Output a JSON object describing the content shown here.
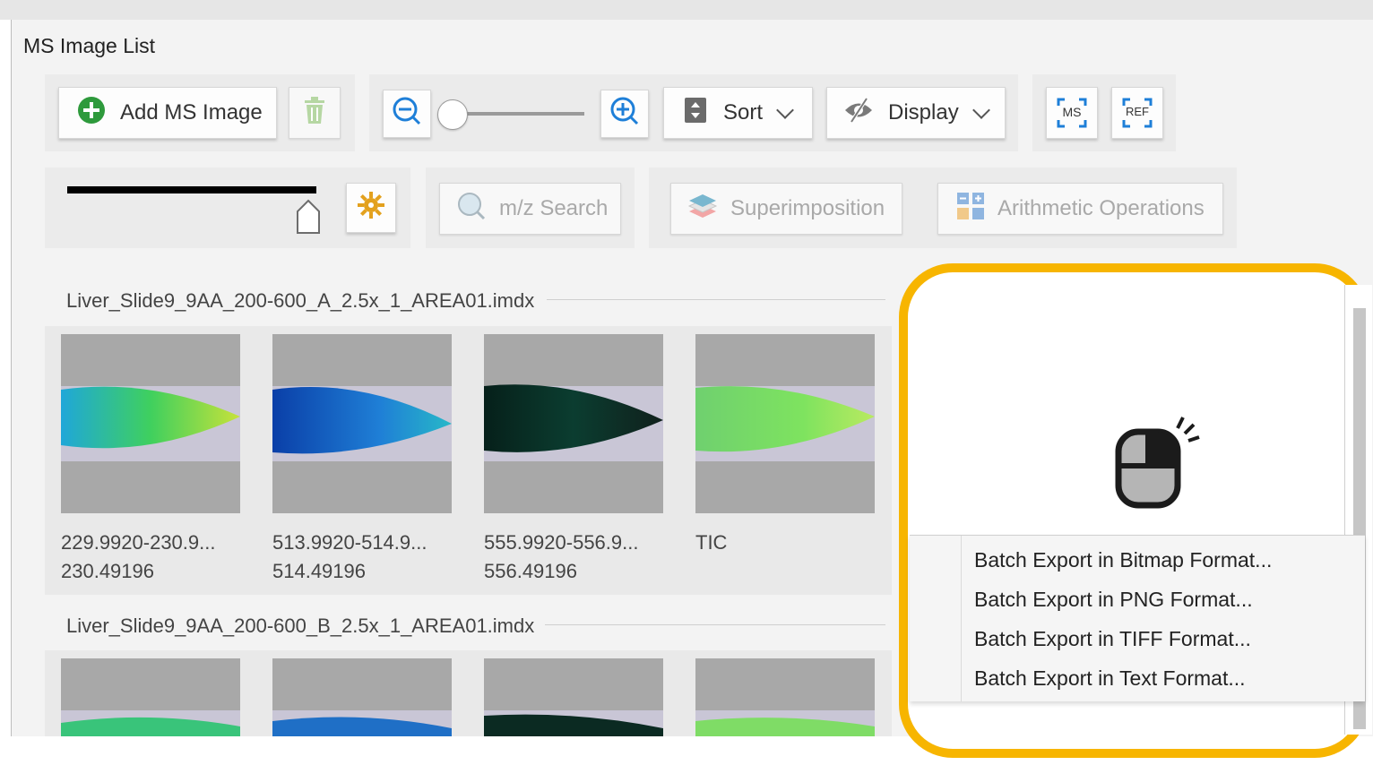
{
  "panel": {
    "title": "MS Image List"
  },
  "toolbar": {
    "add_ms_image": "Add MS Image",
    "sort": "Sort",
    "display": "Display",
    "ms_label": "MS",
    "ref_label": "REF",
    "mz_search": "m/z Search",
    "superimposition": "Superimposition",
    "arithmetic_operations": "Arithmetic Operations"
  },
  "sections": [
    {
      "title": "Liver_Slide9_9AA_200-600_A_2.5x_1_AREA01.imdx",
      "tiles": [
        {
          "line1": "229.9920-230.9...",
          "line2": "230.49196"
        },
        {
          "line1": "513.9920-514.9...",
          "line2": "514.49196"
        },
        {
          "line1": "555.9920-556.9...",
          "line2": "556.49196"
        },
        {
          "line1": "TIC",
          "line2": ""
        }
      ]
    },
    {
      "title": "Liver_Slide9_9AA_200-600_B_2.5x_1_AREA01.imdx"
    }
  ],
  "context_menu": {
    "items": [
      "Batch Export in Bitmap Format...",
      "Batch Export in PNG Format...",
      "Batch Export in TIFF Format...",
      "Batch Export in Text Format..."
    ]
  },
  "colors": {
    "callout": "#f7b500",
    "add_icon": "#2e9a3c",
    "zoom_icon": "#1e7fd8"
  }
}
